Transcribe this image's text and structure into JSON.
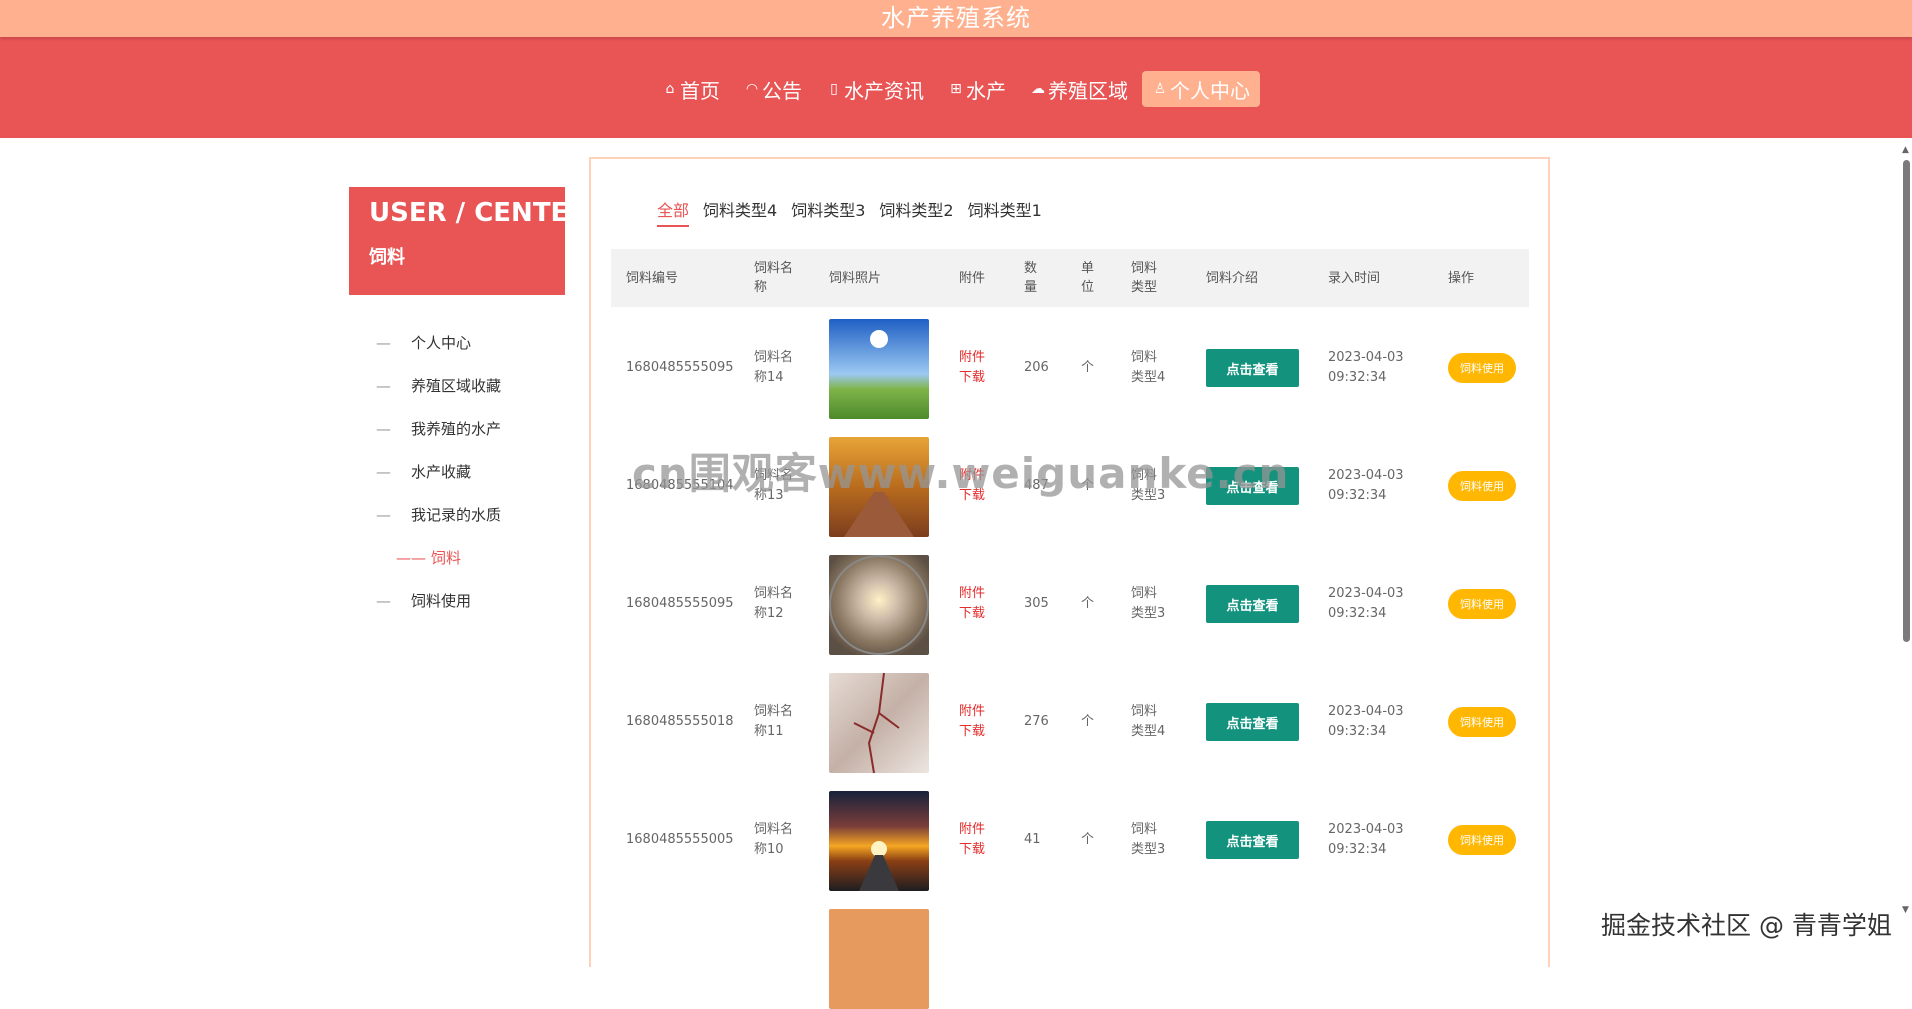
{
  "app": {
    "title": "水产养殖系统"
  },
  "nav": [
    {
      "icon": "home-icon",
      "glyph": "⌂",
      "label": "首页"
    },
    {
      "icon": "notice-icon",
      "glyph": "◠",
      "label": "公告"
    },
    {
      "icon": "news-icon",
      "glyph": "▯",
      "label": "水产资讯"
    },
    {
      "icon": "fish-icon",
      "glyph": "⊞",
      "label": "水产"
    },
    {
      "icon": "area-icon",
      "glyph": "☁",
      "label": "养殖区域"
    },
    {
      "icon": "user-icon",
      "glyph": "♙",
      "label": "个人中心"
    }
  ],
  "sidebar": {
    "title": "USER / CENTER",
    "subtitle": "饲料",
    "items": [
      {
        "dash": "—",
        "label": "个人中心"
      },
      {
        "dash": "—",
        "label": "养殖区域收藏"
      },
      {
        "dash": "—",
        "label": "我养殖的水产"
      },
      {
        "dash": "—",
        "label": "水产收藏"
      },
      {
        "dash": "—",
        "label": "我记录的水质"
      },
      {
        "dash": "——",
        "label": "饲料"
      },
      {
        "dash": "—",
        "label": "饲料使用"
      }
    ]
  },
  "tabs": [
    "全部",
    "饲料类型4",
    "饲料类型3",
    "饲料类型2",
    "饲料类型1"
  ],
  "table": {
    "headers": [
      "饲料编号",
      "饲料名\n称",
      "饲料照片",
      "附件",
      "数\n量",
      "单\n位",
      "饲料\n类型",
      "饲料介绍",
      "录入时间",
      "操作"
    ],
    "rows": [
      {
        "code": "1680485555095",
        "name": "饲料名\n称14",
        "attach": "附件\n下载",
        "qty": "206",
        "unit": "个",
        "type": "饲料\n类型4",
        "intro": "点击查看",
        "time": "2023-04-03\n09:32:34",
        "op": "饲料使用",
        "photo": "sky-meadow"
      },
      {
        "code": "1680485555104",
        "name": "饲料名\n称13",
        "attach": "附件\n下载",
        "qty": "487",
        "unit": "个",
        "type": "饲料\n类型3",
        "intro": "点击查看",
        "time": "2023-04-03\n09:32:34",
        "op": "饲料使用",
        "photo": "autumn-road"
      },
      {
        "code": "1680485555095",
        "name": "饲料名\n称12",
        "attach": "附件\n下载",
        "qty": "305",
        "unit": "个",
        "type": "饲料\n类型3",
        "intro": "点击查看",
        "time": "2023-04-03\n09:32:34",
        "op": "饲料使用",
        "photo": "desert-sunset"
      },
      {
        "code": "1680485555018",
        "name": "饲料名\n称11",
        "attach": "附件\n下载",
        "qty": "276",
        "unit": "个",
        "type": "饲料\n类型4",
        "intro": "点击查看",
        "time": "2023-04-03\n09:32:34",
        "op": "饲料使用",
        "photo": "blossom"
      },
      {
        "code": "1680485555005",
        "name": "饲料名\n称10",
        "attach": "附件\n下载",
        "qty": "41",
        "unit": "个",
        "type": "饲料\n类型3",
        "intro": "点击查看",
        "time": "2023-04-03\n09:32:34",
        "op": "饲料使用",
        "photo": "sunset-road"
      }
    ]
  },
  "watermark": "cn围观客www.weiguanke.cn",
  "credit": "掘金技术社区 @ 青青学姐",
  "colors": {
    "accent": "#e95455",
    "topbar": "#ffb18f",
    "teal": "#13927d",
    "yellow": "#ffb701"
  }
}
